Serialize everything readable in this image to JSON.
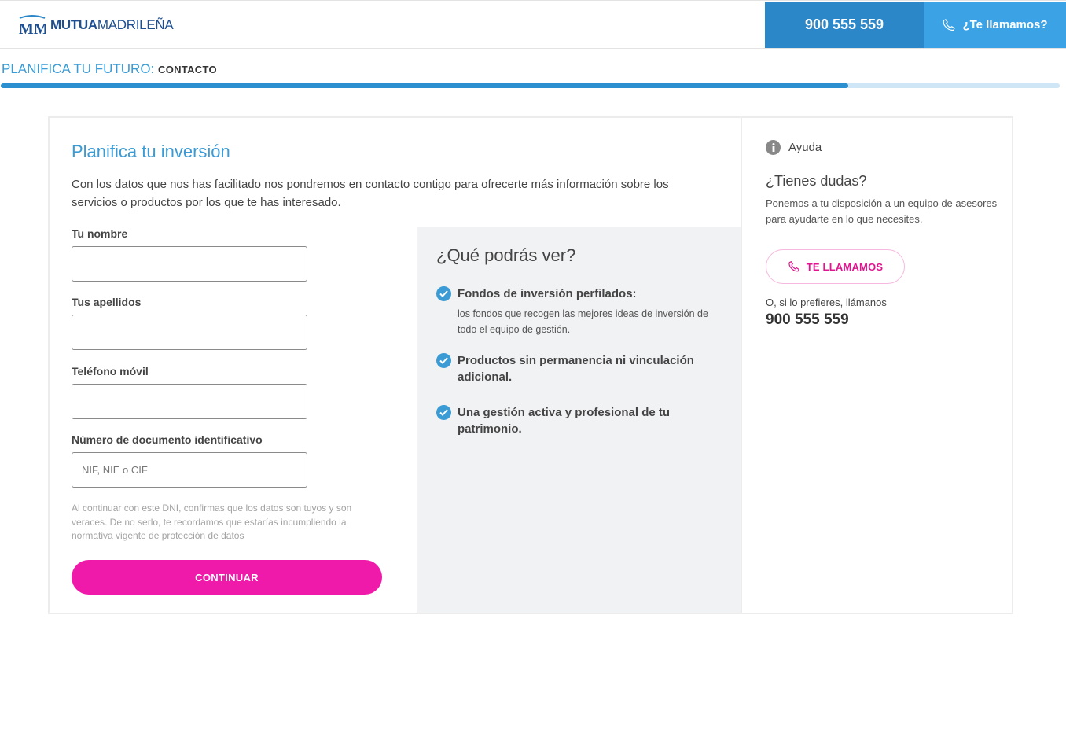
{
  "header": {
    "logo_bold": "MUTUA",
    "logo_light": "MADRILEÑA",
    "phone": "900 555 559",
    "call_label": "¿Te llamamos?"
  },
  "breadcrumb": {
    "section": "PLANIFICA TU FUTURO:",
    "current": "CONTACTO",
    "progress_percent": 80
  },
  "form": {
    "title": "Planifica tu inversión",
    "intro": "Con los datos que nos has facilitado nos pondremos en contacto contigo para ofrecerte más información sobre los servicios o productos por los que te has interesado.",
    "fields": [
      {
        "label": "Tu nombre",
        "value": "",
        "placeholder": ""
      },
      {
        "label": "Tus apellidos",
        "value": "",
        "placeholder": ""
      },
      {
        "label": "Teléfono móvil",
        "value": "",
        "placeholder": ""
      },
      {
        "label": "Número de documento identificativo",
        "value": "",
        "placeholder": "NIF, NIE o CIF"
      }
    ],
    "disclaimer": "Al continuar con este DNI, confirmas que los datos son tuyos y son veraces. De no serlo, te recordamos que estarías incumpliendo la normativa vigente de protección de datos",
    "continue_label": "CONTINUAR"
  },
  "features": {
    "title": "¿Qué podrás ver?",
    "items": [
      {
        "title": "Fondos de inversión perfilados:",
        "desc": "los fondos que recogen las mejores ideas de inversión de todo el equipo de gestión."
      },
      {
        "title": "Productos sin permanencia ni vinculación adicional.",
        "desc": ""
      },
      {
        "title": "Una gestión activa y profesional de tu patrimonio.",
        "desc": ""
      }
    ]
  },
  "help": {
    "heading": "Ayuda",
    "question": "¿Tienes dudas?",
    "desc": "Ponemos a tu disposición a un equipo de asesores para ayudarte en lo que necesites.",
    "call_button": "TE LLAMAMOS",
    "prefer_text": "O, si lo prefieres, llámanos",
    "phone": "900 555 559"
  },
  "colors": {
    "brand_blue": "#2c87c9",
    "light_blue": "#3ba3e5",
    "accent_pink": "#f01aaa",
    "title_blue": "#3a9bd5"
  },
  "icons": [
    "mm-logo-icon",
    "phone-icon",
    "check-icon",
    "info-icon"
  ]
}
